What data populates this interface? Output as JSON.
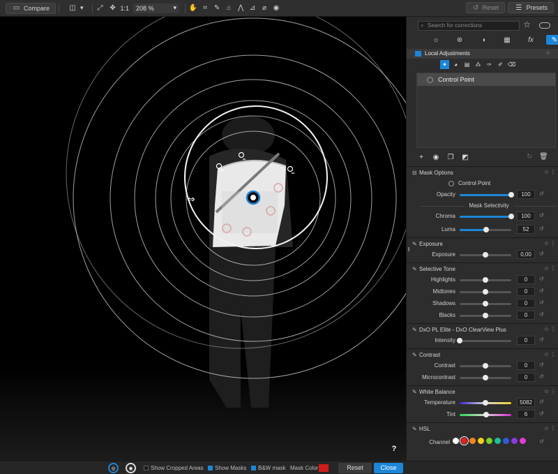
{
  "toolbar": {
    "compare_label": "Compare",
    "one_to_one": "1:1",
    "zoom_value": "208 %",
    "reset_label": "Reset",
    "presets_label": "Presets"
  },
  "bottom": {
    "show_cropped": "Show Cropped Areas",
    "show_masks": "Show Masks",
    "bw_mask": "B&W mask",
    "mask_color": "Mask Color",
    "mask_color_hex": "#d21c1c",
    "reset": "Reset",
    "close": "Close"
  },
  "panel": {
    "search_placeholder": "Search for corrections",
    "local_adjustments": "Local Adjustments",
    "control_point_item": "Control Point",
    "mask_options": {
      "title": "Mask Options",
      "type_label": "Control Point",
      "opacity": {
        "label": "Opacity",
        "value": "100",
        "pct": 100
      },
      "selectivity_label": "Mask Selectivity",
      "chroma": {
        "label": "Chroma",
        "value": "100",
        "pct": 100
      },
      "luma": {
        "label": "Luma",
        "value": "52",
        "pct": 52
      }
    },
    "exposure": {
      "title": "Exposure",
      "exposure": {
        "label": "Exposure",
        "value": "0,00",
        "pct": 50
      }
    },
    "selective_tone": {
      "title": "Selective Tone",
      "highlights": {
        "label": "Highlights",
        "value": "0",
        "pct": 50
      },
      "midtones": {
        "label": "Midtones",
        "value": "0",
        "pct": 50
      },
      "shadows": {
        "label": "Shadows",
        "value": "0",
        "pct": 50
      },
      "blacks": {
        "label": "Blacks",
        "value": "0",
        "pct": 50
      }
    },
    "clearview": {
      "title": "DxO PL Elite - DxO ClearView Plus",
      "intensity": {
        "label": "Intensity",
        "value": "0",
        "pct": 0
      }
    },
    "contrast": {
      "title": "Contrast",
      "contrast": {
        "label": "Contrast",
        "value": "0",
        "pct": 50
      },
      "microcontrast": {
        "label": "Microcontrast",
        "value": "0",
        "pct": 50
      }
    },
    "white_balance": {
      "title": "White Balance",
      "temperature": {
        "label": "Temperature",
        "value": "5082",
        "pct": 50
      },
      "tint": {
        "label": "Tint",
        "value": "6",
        "pct": 52
      }
    },
    "hsl": {
      "title": "HSL",
      "channel_label": "Channel",
      "channels": [
        "#ffffff",
        "#e12020",
        "#f5841f",
        "#f0d020",
        "#7ed321",
        "#19c39a",
        "#2f5bdb",
        "#8b3bdb",
        "#e23bd6"
      ]
    }
  },
  "viewer": {
    "help": "?"
  },
  "colors": {
    "accent": "#1c86d8"
  }
}
